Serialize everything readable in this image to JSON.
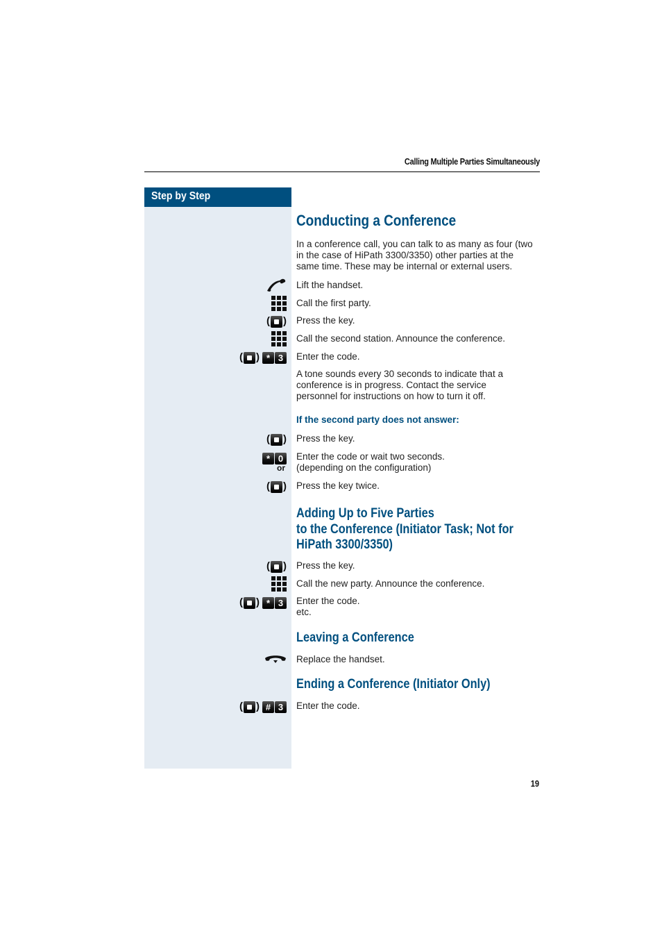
{
  "running_head": "Calling Multiple Parties Simultaneously",
  "sidebar_title": "Step by Step",
  "page_number": "19",
  "sections": {
    "conducting": {
      "title": "Conducting a Conference",
      "intro": [
        "In a conference call, you can talk to as many as four (two",
        "in the case of HiPath 3300/3350) other parties at the",
        "same time. These may be internal or external users."
      ],
      "steps": [
        {
          "icon": "handset-lift-icon",
          "text": "Lift the handset."
        },
        {
          "icon": "keypad-icon",
          "text": "Call the first party."
        },
        {
          "icon": "function-key-icon",
          "text": "Press the key."
        },
        {
          "icon": "keypad-icon",
          "text": "Call the second station. Announce the conference."
        },
        {
          "icon": "function-key-star-3-icon",
          "keys": [
            "*",
            "3"
          ],
          "text": "Enter the code."
        }
      ],
      "note": [
        "A tone sounds every 30 seconds to indicate that a",
        "conference is in progress. Contact the service",
        "personnel for instructions on how to turn it off."
      ],
      "sub_heading": "If the second party does not answer:",
      "no_answer_steps": [
        {
          "icon": "function-key-icon",
          "text": "Press the key."
        },
        {
          "icon": "star-0-keys-icon",
          "keys": [
            "*",
            "0"
          ],
          "or_label": "or",
          "text": "Enter the code or wait two seconds.",
          "text2": "(depending on the configuration)"
        },
        {
          "icon": "function-key-icon",
          "text": "Press the key twice."
        }
      ]
    },
    "adding": {
      "title_lines": [
        "Adding Up to Five Parties",
        "to the Conference (Initiator Task; Not for",
        "HiPath 3300/3350)"
      ],
      "steps": [
        {
          "icon": "function-key-icon",
          "text": "Press the key."
        },
        {
          "icon": "keypad-icon",
          "text": "Call the new party. Announce the conference."
        },
        {
          "icon": "function-key-star-3-icon",
          "keys": [
            "*",
            "3"
          ],
          "text": "Enter the code.",
          "text2": "etc."
        }
      ]
    },
    "leaving": {
      "title": "Leaving a Conference",
      "steps": [
        {
          "icon": "handset-replace-icon",
          "text": "Replace the handset."
        }
      ]
    },
    "ending": {
      "title": "Ending a Conference (Initiator Only)",
      "steps": [
        {
          "icon": "function-key-hash-3-icon",
          "keys": [
            "#",
            "3"
          ],
          "text": "Enter the code."
        }
      ]
    }
  }
}
